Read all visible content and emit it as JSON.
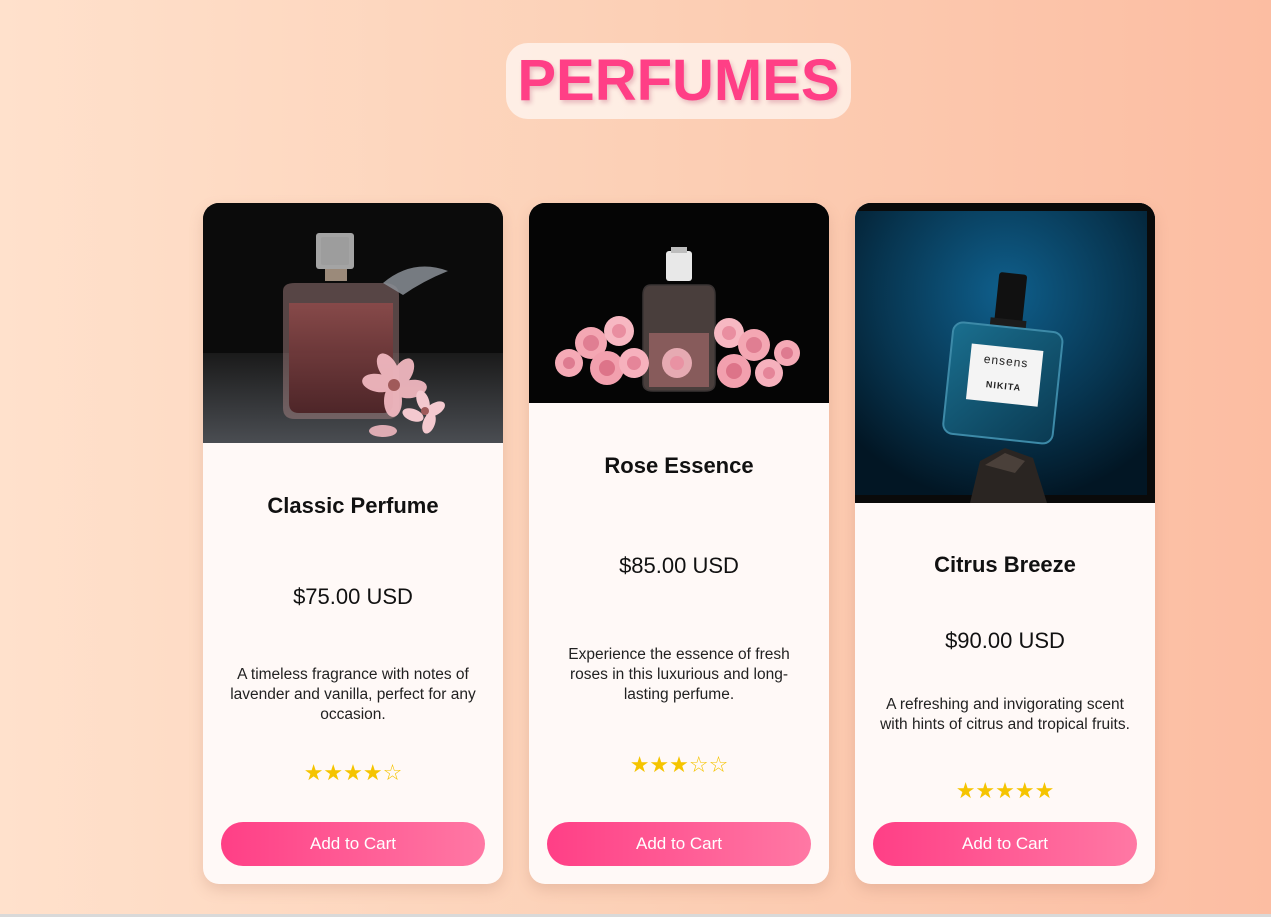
{
  "page": {
    "title": "PERFUMES",
    "accent_color": "#ff3f86",
    "star_color": "#f5c400"
  },
  "products": [
    {
      "name": "Classic Perfume",
      "price": "$75.00 USD",
      "description": "A timeless fragrance with notes of lavender and vanilla, perfect for any occasion.",
      "rating": 4,
      "rating_max": 5,
      "rating_display": "★★★★☆",
      "button_label": "Add to Cart",
      "image_icon": "perfume-bottle-with-flowers-image"
    },
    {
      "name": "Rose Essence",
      "price": "$85.00 USD",
      "description": "Experience the essence of fresh roses in this luxurious and long-lasting perfume.",
      "rating": 3,
      "rating_max": 5,
      "rating_display": "★★★☆☆",
      "button_label": "Add to Cart",
      "image_icon": "perfume-bottle-with-roses-image"
    },
    {
      "name": "Citrus Breeze",
      "price": "$90.00 USD",
      "description": "A refreshing and invigorating scent with hints of citrus and tropical fruits.",
      "rating": 5,
      "rating_max": 5,
      "rating_display": "★★★★★",
      "button_label": "Add to Cart",
      "image_icon": "ensens-nikita-bottle-image",
      "label_brand": "ensens",
      "label_name": "NIKITA"
    }
  ]
}
